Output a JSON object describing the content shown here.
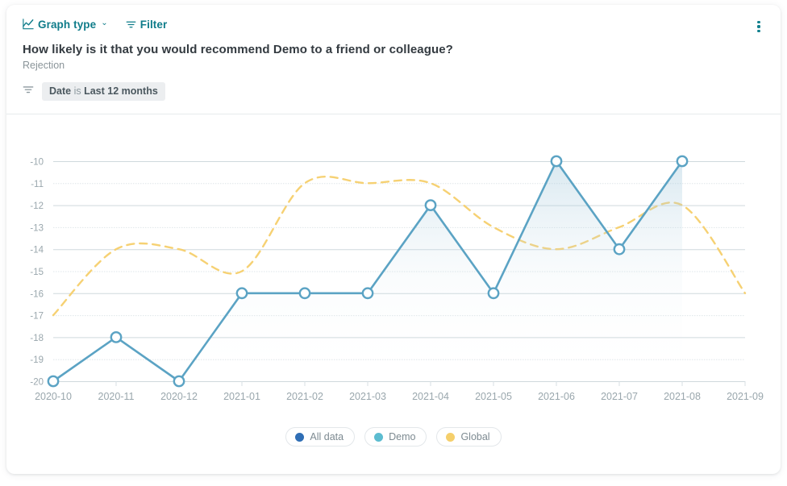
{
  "toolbar": {
    "graph_type_label": "Graph type",
    "graph_type_icon": "line-chart-icon",
    "graph_type_chevron": "⌄",
    "filter_label": "Filter",
    "filter_icon": "filter-icon",
    "menu_icon": "kebab-menu-icon"
  },
  "header": {
    "title": "How likely is it that you would recommend Demo to a friend or colleague?",
    "subtitle": "Rejection"
  },
  "active_filter": {
    "icon": "filter-icon",
    "field": "Date",
    "operator": "is",
    "value": "Last 12 months"
  },
  "legend": [
    {
      "label": "All data",
      "color": "#2f6eb5"
    },
    {
      "label": "Demo",
      "color": "#5cbcd0"
    },
    {
      "label": "Global",
      "color": "#f5cf6b"
    }
  ],
  "colors": {
    "accent_teal": "#0f7c8a",
    "demo_line": "#5ba3c4",
    "global_line": "#f5c濾"
  },
  "chart_data": {
    "type": "line",
    "title": "How likely is it that you would recommend Demo to a friend or colleague?",
    "subtitle": "Rejection",
    "xlabel": "",
    "ylabel": "",
    "grid": true,
    "legend_position": "bottom",
    "ylim": [
      -20,
      -10
    ],
    "yticks": [
      "-10",
      "-11",
      "-12",
      "-13",
      "-14",
      "-15",
      "-16",
      "-17",
      "-18",
      "-19",
      "-20"
    ],
    "categories": [
      "2020-10",
      "2020-11",
      "2020-12",
      "2021-01",
      "2021-02",
      "2021-03",
      "2021-04",
      "2021-05",
      "2021-06",
      "2021-07",
      "2021-08",
      "2021-09"
    ],
    "series": [
      {
        "name": "All data",
        "color": "#2f6eb5",
        "style": "none",
        "values": [
          null,
          null,
          null,
          null,
          null,
          null,
          null,
          null,
          null,
          null,
          null,
          null
        ]
      },
      {
        "name": "Demo",
        "color": "#5ba3c4",
        "style": "solid-markers-area",
        "values": [
          -20,
          -18,
          -20,
          -16,
          -16,
          -16,
          -12,
          -16,
          -10,
          -14,
          -10,
          null
        ]
      },
      {
        "name": "Global",
        "color": "#f5cf6b",
        "style": "dashed-smooth",
        "values": [
          -17,
          -14,
          -14,
          -15,
          -11,
          -11,
          -11,
          -13,
          -14,
          -13,
          -12,
          -16
        ]
      }
    ]
  }
}
